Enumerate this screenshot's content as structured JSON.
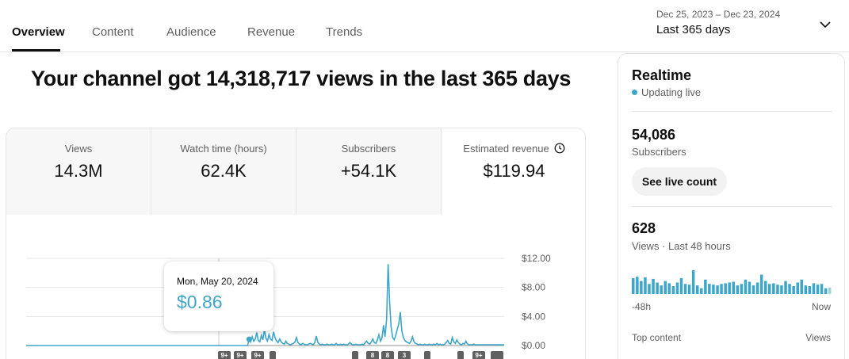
{
  "tabs": [
    {
      "label": "Overview",
      "active": true
    },
    {
      "label": "Content"
    },
    {
      "label": "Audience"
    },
    {
      "label": "Revenue"
    },
    {
      "label": "Trends"
    }
  ],
  "date_range": {
    "range": "Dec 25, 2023 – Dec 23, 2024",
    "label": "Last 365 days"
  },
  "headline": "Your channel got 14,318,717 views in the last 365 days",
  "metrics": [
    {
      "label": "Views",
      "value": "14.3M"
    },
    {
      "label": "Watch time (hours)",
      "value": "62.4K"
    },
    {
      "label": "Subscribers",
      "value": "+54.1K"
    },
    {
      "label": "Estimated revenue",
      "value": "$119.94",
      "icon": "clock-icon",
      "active": true
    }
  ],
  "tooltip": {
    "date": "Mon, May 20, 2024",
    "value": "$0.86"
  },
  "chart_data": {
    "type": "line",
    "y_tick_labels": [
      "$12.00",
      "$8.00",
      "$4.00",
      "$0.00"
    ],
    "ylim": [
      0,
      12
    ],
    "grid": true,
    "color": "#3ea6c9",
    "series": [
      {
        "values": [
          0,
          0,
          0,
          0,
          0,
          0,
          0,
          0,
          0,
          0,
          0,
          0,
          0,
          0,
          0,
          0,
          0,
          0,
          0,
          0,
          0,
          0,
          0,
          0,
          0,
          0,
          0,
          0,
          0,
          0,
          0,
          0,
          0,
          0,
          0,
          0,
          0,
          0,
          0,
          0,
          0,
          0,
          0,
          0,
          0,
          0,
          0,
          0,
          0,
          0,
          0,
          0,
          0,
          0,
          0,
          0,
          0,
          0,
          0,
          0,
          0,
          0,
          0,
          0,
          0,
          0,
          0,
          0,
          0,
          0,
          0,
          0,
          0,
          0,
          0,
          0,
          0,
          0,
          0,
          0,
          0,
          0,
          0,
          0,
          0,
          0,
          0,
          0,
          0,
          0,
          0,
          0,
          0,
          0,
          0,
          0,
          0,
          0,
          0,
          0,
          0,
          0,
          0,
          0,
          0,
          0,
          0,
          0,
          0,
          0,
          0,
          0,
          0,
          0,
          0,
          0,
          0,
          0,
          0,
          0,
          0,
          0,
          0,
          0,
          0,
          0,
          0,
          0,
          0,
          0,
          0,
          0,
          0,
          0,
          0,
          0,
          0,
          0,
          0,
          0,
          0,
          0,
          0,
          0,
          0,
          0,
          0.86,
          0.5,
          1.2,
          0.6,
          0.9,
          1.8,
          0.7,
          0.5,
          1.4,
          0.8,
          2.2,
          1.0,
          0.6,
          1.5,
          0.9,
          0.7,
          1.9,
          1.1,
          0.6,
          0.4,
          0.9,
          0.5,
          0.3,
          0.2,
          0.6,
          0.3,
          0.2,
          0.1,
          0.2,
          0.3,
          0.5,
          1.1,
          0.4,
          0.2,
          0.1,
          0.3,
          0.2,
          0.1,
          0.1,
          0.2,
          0.3,
          0.2,
          0.1,
          0.4,
          1.3,
          0.4,
          0.2,
          0.1,
          0.2,
          0.1,
          0.1,
          0.2,
          0.1,
          0.1,
          0.2,
          0.1,
          0.1,
          0.3,
          0.1,
          0.1,
          0.2,
          0.1,
          0.2,
          0.1,
          0.1,
          0.2,
          0.4,
          0.2,
          0.1,
          0.1,
          0.2,
          0.1,
          0.1,
          0.1,
          0.2,
          0.1,
          0.4,
          0.6,
          0.3,
          0.2,
          0.5,
          0.9,
          0.4,
          0.3,
          0.8,
          1.5,
          0.6,
          1.0,
          2.8,
          1.2,
          3.6,
          11.2,
          6.0,
          2.5,
          1.1,
          0.8,
          1.4,
          2.2,
          3.0,
          4.6,
          2.0,
          1.1,
          0.7,
          0.5,
          0.4,
          0.3,
          0.6,
          1.2,
          0.5,
          0.3,
          0.2,
          0.1,
          0.2,
          0.1,
          0.1,
          0.2,
          0.1,
          0.1,
          0.2,
          0.1,
          0.1,
          0.2,
          0.1,
          0.3,
          0.1,
          0.2,
          0.1,
          0.1,
          0.2,
          0.4,
          0.7,
          0.3,
          0.2,
          1.1,
          0.5,
          0.3,
          0.8,
          0.4,
          0.2,
          0.1,
          0.3,
          0.2,
          0.6,
          0.2,
          0.1,
          0.1,
          0.1,
          0.2,
          0.1,
          0.1,
          0.1,
          0.1,
          0.1,
          0.1,
          0.1,
          0.1,
          0.1,
          0.1,
          0.1,
          0.1,
          0.1,
          0.1,
          0.1,
          0.1,
          0.1,
          0.1,
          0.1,
          0.1
        ]
      }
    ]
  },
  "realtime": {
    "title": "Realtime",
    "status": "Updating live",
    "subscribers_value": "54,086",
    "subscribers_label": "Subscribers",
    "live_button": "See live count",
    "views_value": "628",
    "views_label": "Views · Last 48 hours",
    "axis_start": "-48h",
    "axis_end": "Now",
    "top_content_label": "Top content",
    "top_content_col": "Views",
    "bar_color": "#3ea6c9",
    "bars": [
      22,
      24,
      18,
      23,
      14,
      21,
      16,
      12,
      18,
      15,
      11,
      16,
      22,
      14,
      13,
      33,
      12,
      8,
      20,
      14,
      13,
      12,
      14,
      15,
      16,
      17,
      12,
      14,
      20,
      17,
      12,
      16,
      27,
      18,
      14,
      15,
      13,
      12,
      18,
      14,
      11,
      16,
      20,
      12,
      11,
      15,
      13,
      14,
      8,
      9
    ]
  },
  "markers": [
    "9+",
    "9+",
    "9+",
    "",
    "",
    "8",
    "8",
    "3",
    "",
    "",
    "9+",
    "4",
    ""
  ]
}
